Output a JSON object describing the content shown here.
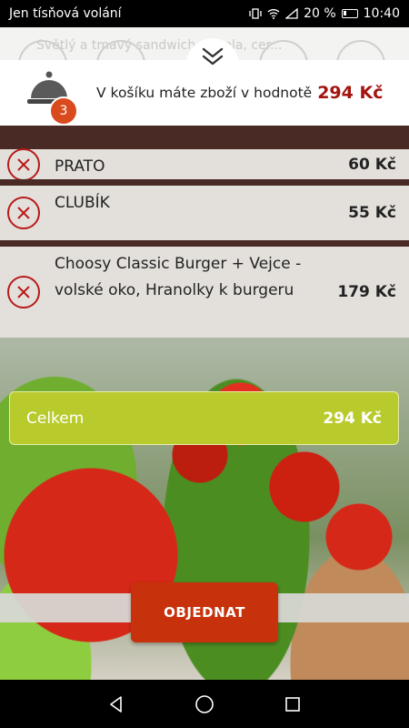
{
  "status_bar": {
    "carrier": "Jen tísňová volání",
    "battery": "20 %",
    "time": "10:40"
  },
  "background_text": "Světlý a tmavý sandwich, rucola, cer...",
  "cart": {
    "count": "3",
    "summary_text": "V košíku máte zboží v hodnotě",
    "summary_total": "294 Kč",
    "items": [
      {
        "name": "PRATO",
        "price": "60 Kč"
      },
      {
        "name": "CLUBÍK",
        "price": "55 Kč"
      },
      {
        "name": "Choosy Classic Burger + Vejce - volské oko, Hranolky k burgeru",
        "price": "179 Kč"
      }
    ],
    "total_label": "Celkem",
    "total_value": "294 Kč"
  },
  "order_button_label": "OBJEDNAT",
  "colors": {
    "accent_red": "#a3140f",
    "badge": "#d94a1c",
    "total_bar": "#b9cb2c",
    "order_button": "#c7310c",
    "separator": "#4a2a24"
  },
  "icons": {
    "cart": "cloche-icon",
    "collapse": "chevron-double-down-icon",
    "remove": "close-circle-icon"
  }
}
